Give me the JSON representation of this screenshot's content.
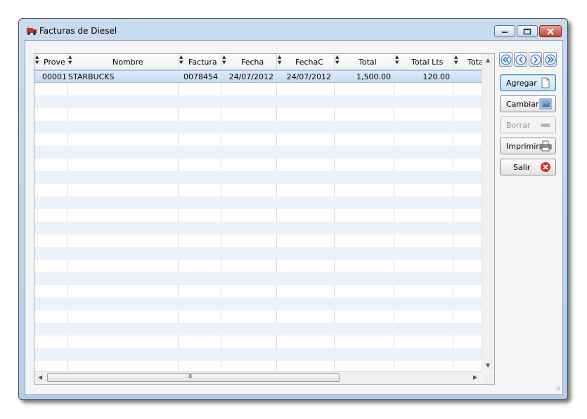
{
  "window": {
    "title": "Facturas de Diesel",
    "accent_color": "#c9dcef"
  },
  "grid": {
    "columns": [
      {
        "label": "Prove"
      },
      {
        "label": "Nombre"
      },
      {
        "label": "Factura"
      },
      {
        "label": "Fecha"
      },
      {
        "label": "FechaC"
      },
      {
        "label": "Total"
      },
      {
        "label": "Total Lts"
      },
      {
        "label": "Tota"
      }
    ],
    "rows": [
      {
        "prove": "00001",
        "nombre": "STARBUCKS",
        "factura": "0078454",
        "fecha": "24/07/2012",
        "fechac": "24/07/2012",
        "total": "1,500.00",
        "total_lts": "120.00",
        "tota": ""
      }
    ],
    "hscroll_grip": "III"
  },
  "nav": {
    "first_icon": "double-chevron-left-icon",
    "prev_icon": "chevron-left-icon",
    "next_icon": "chevron-right-icon",
    "last_icon": "double-chevron-right-icon"
  },
  "actions": {
    "agregar": "Agregar",
    "cambiar": "Cambiar",
    "borrar": "Borrar",
    "imprimir": "Imprimir",
    "salir": "Salir"
  }
}
